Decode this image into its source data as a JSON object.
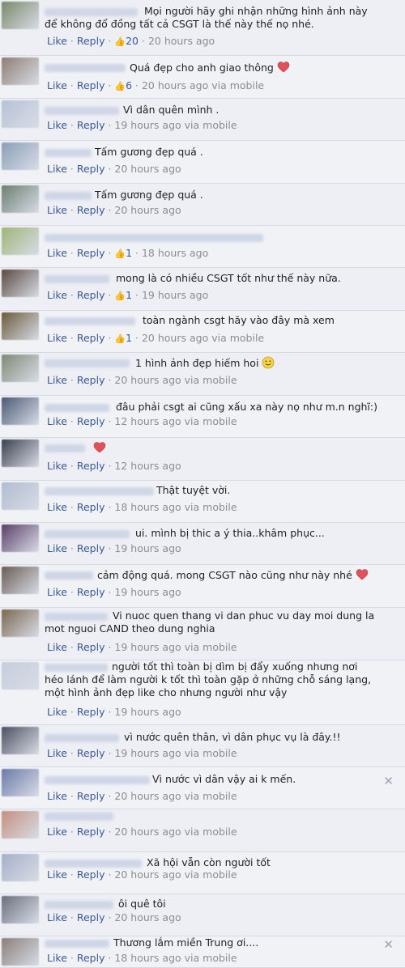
{
  "labels": {
    "like": "Like",
    "reply": "Reply",
    "dot": "·",
    "via": "via mobile"
  },
  "colors": {
    "link": "#3b5998",
    "meta": "#8a8d91",
    "heart": "#e0515a"
  },
  "comments": [
    {
      "lines": [
        "Mọi người hãy ghi nhận những hình ảnh này",
        "để không đổ đồng tất cả CSGT là thế này thế nọ nhé."
      ],
      "likes": "20",
      "time": "20 hours ago",
      "mobile": false,
      "emoji": "",
      "close": false
    },
    {
      "lines": [
        "Quá đẹp cho anh giao thông"
      ],
      "likes": "6",
      "time": "20 hours ago",
      "mobile": true,
      "emoji": "heart",
      "close": false
    },
    {
      "lines": [
        "Vì dân quên mình ."
      ],
      "likes": "",
      "time": "19 hours ago",
      "mobile": true,
      "emoji": "",
      "close": false
    },
    {
      "lines": [
        "Tấm gương đẹp quá ."
      ],
      "likes": "",
      "time": "20 hours ago",
      "mobile": false,
      "emoji": "",
      "close": false
    },
    {
      "lines": [
        "Tấm gương đẹp quá ."
      ],
      "likes": "",
      "time": "20 hours ago",
      "mobile": false,
      "emoji": "",
      "close": false
    },
    {
      "lines": [
        ""
      ],
      "likes": "1",
      "time": "18 hours ago",
      "mobile": false,
      "emoji": "",
      "close": false
    },
    {
      "lines": [
        "mong là có nhiều CSGT tốt như thế này nữa."
      ],
      "likes": "1",
      "time": "19 hours ago",
      "mobile": false,
      "emoji": "",
      "close": false
    },
    {
      "lines": [
        "toàn ngành csgt hãy vào đây mà xem"
      ],
      "likes": "1",
      "time": "20 hours ago",
      "mobile": true,
      "emoji": "",
      "close": false
    },
    {
      "lines": [
        "1 hình ảnh đẹp hiếm hoi"
      ],
      "likes": "",
      "time": "20 hours ago",
      "mobile": true,
      "emoji": "smile",
      "close": false
    },
    {
      "lines": [
        "đâu phải csgt ai cũng xấu xa này nọ như m.n nghĩ:)"
      ],
      "likes": "",
      "time": "12 hours ago",
      "mobile": true,
      "emoji": "",
      "close": false
    },
    {
      "lines": [
        ""
      ],
      "likes": "",
      "time": "12 hours ago",
      "mobile": false,
      "emoji": "heart",
      "close": false
    },
    {
      "lines": [
        "Thật tuyệt vời."
      ],
      "likes": "",
      "time": "18 hours ago",
      "mobile": true,
      "emoji": "",
      "close": false
    },
    {
      "lines": [
        "ui. mình bị thic a ý thia..khâm phục..."
      ],
      "likes": "",
      "time": "19 hours ago",
      "mobile": false,
      "emoji": "",
      "close": false
    },
    {
      "lines": [
        "cảm động quá. mong CSGT nào cũng như này nhé"
      ],
      "likes": "",
      "time": "19 hours ago",
      "mobile": false,
      "emoji": "heart",
      "close": false
    },
    {
      "lines": [
        "Vi nuoc quen thang vi dan phuc vu day moi dung la",
        "mot nguoi CAND theo dung nghia"
      ],
      "likes": "",
      "time": "19 hours ago",
      "mobile": true,
      "emoji": "",
      "close": false
    },
    {
      "lines": [
        "người tốt thì toàn bị dìm bị đẩy xuống nhưng nơi",
        "héo lánh để làm người k tốt thì toàn gặp ở những chỗ sáng lạng,",
        "một hình ảnh đẹp like cho nhưng người như vậy"
      ],
      "likes": "",
      "time": "19 hours ago",
      "mobile": false,
      "emoji": "",
      "close": false
    },
    {
      "lines": [
        "vì nước quên thân, vì dân phục vụ là đây.!!"
      ],
      "likes": "",
      "time": "19 hours ago",
      "mobile": true,
      "emoji": "",
      "close": false
    },
    {
      "lines": [
        "Vì nước vì dân vậy ai k mến."
      ],
      "likes": "",
      "time": "20 hours ago",
      "mobile": true,
      "emoji": "",
      "close": true
    },
    {
      "lines": [
        ""
      ],
      "likes": "",
      "time": "20 hours ago",
      "mobile": true,
      "emoji": "",
      "close": false
    },
    {
      "lines": [
        "Xã hội vẫn còn người tốt"
      ],
      "likes": "",
      "time": "20 hours ago",
      "mobile": true,
      "emoji": "",
      "close": false
    },
    {
      "lines": [
        "ôi quê tôi"
      ],
      "likes": "",
      "time": "20 hours ago",
      "mobile": false,
      "emoji": "",
      "close": false
    },
    {
      "lines": [
        "Thương lắm miền Trung ơi...."
      ],
      "likes": "",
      "time": "18 hours ago",
      "mobile": true,
      "emoji": "",
      "close": true
    }
  ]
}
